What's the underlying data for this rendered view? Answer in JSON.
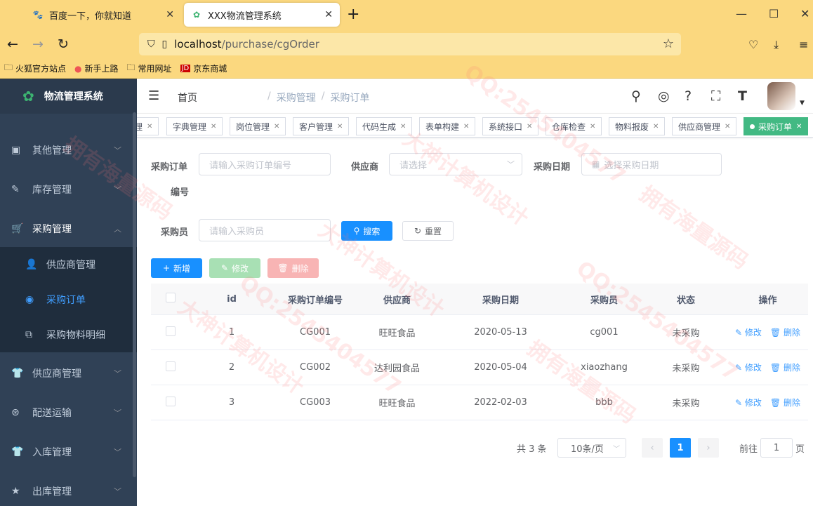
{
  "browser": {
    "tabs": [
      {
        "title": "百度一下，你就知道",
        "icon": "paw-icon"
      },
      {
        "title": "XXX物流管理系统",
        "icon": "leaf-icon"
      }
    ],
    "url_host": "localhost",
    "url_path": "/purchase/cgOrder",
    "bookmarks": [
      "火狐官方站点",
      "新手上路",
      "常用网址",
      "京东商城"
    ]
  },
  "sidebar": {
    "brand": "物流管理系统",
    "items": [
      {
        "label": "其他管理",
        "icon": "briefcase-icon"
      },
      {
        "label": "库存管理",
        "icon": "edit-icon"
      },
      {
        "label": "采购管理",
        "icon": "cart-icon"
      },
      {
        "label": "供应商管理",
        "icon": "shirt-icon"
      },
      {
        "label": "配送运输",
        "icon": "lifebuoy-icon"
      },
      {
        "label": "入库管理",
        "icon": "shirt-icon"
      },
      {
        "label": "出库管理",
        "icon": "star-icon"
      }
    ],
    "sub_items": [
      {
        "label": "供应商管理",
        "icon": "user-icon"
      },
      {
        "label": "采购订单",
        "icon": "dashboard-icon"
      },
      {
        "label": "采购物料明细",
        "icon": "box-icon"
      }
    ]
  },
  "header": {
    "breadcrumb": [
      "首页",
      "采购管理",
      "采购订单"
    ]
  },
  "tags": [
    "理",
    "字典管理",
    "岗位管理",
    "客户管理",
    "代码生成",
    "表单构建",
    "系统接口",
    "仓库检查",
    "物料报废",
    "供应商管理",
    "采购订单"
  ],
  "search": {
    "order_no_label": "采购订单",
    "order_no_label2": "编号",
    "order_no_placeholder": "请输入采购订单编号",
    "supplier_label": "供应商",
    "supplier_placeholder": "请选择",
    "date_label": "采购日期",
    "date_placeholder": "选择采购日期",
    "buyer_label": "采购员",
    "buyer_placeholder": "请输入采购员",
    "search_button": "搜索",
    "reset_button": "重置"
  },
  "toolbar": {
    "add": "新增",
    "edit": "修改",
    "delete": "删除"
  },
  "table": {
    "columns": [
      "id",
      "采购订单编号",
      "供应商",
      "采购日期",
      "采购员",
      "状态",
      "操作"
    ],
    "rows": [
      {
        "id": "1",
        "code": "CG001",
        "supplier": "旺旺食品",
        "date": "2020-05-13",
        "buyer": "cg001",
        "status": "未采购"
      },
      {
        "id": "2",
        "code": "CG002",
        "supplier": "达利园食品",
        "date": "2020-05-04",
        "buyer": "xiaozhang",
        "status": "未采购"
      },
      {
        "id": "3",
        "code": "CG003",
        "supplier": "旺旺食品",
        "date": "2022-02-03",
        "buyer": "bbb",
        "status": "未采购"
      }
    ],
    "op_edit": "修改",
    "op_delete": "删除"
  },
  "pagination": {
    "total": "共 3 条",
    "page_size": "10条/页",
    "current": "1",
    "goto_label": "前往",
    "goto_value": "1",
    "page_unit": "页"
  },
  "watermarks": [
    "大神计算机设计",
    "QQ:2545404577",
    "拥有海量源码"
  ]
}
